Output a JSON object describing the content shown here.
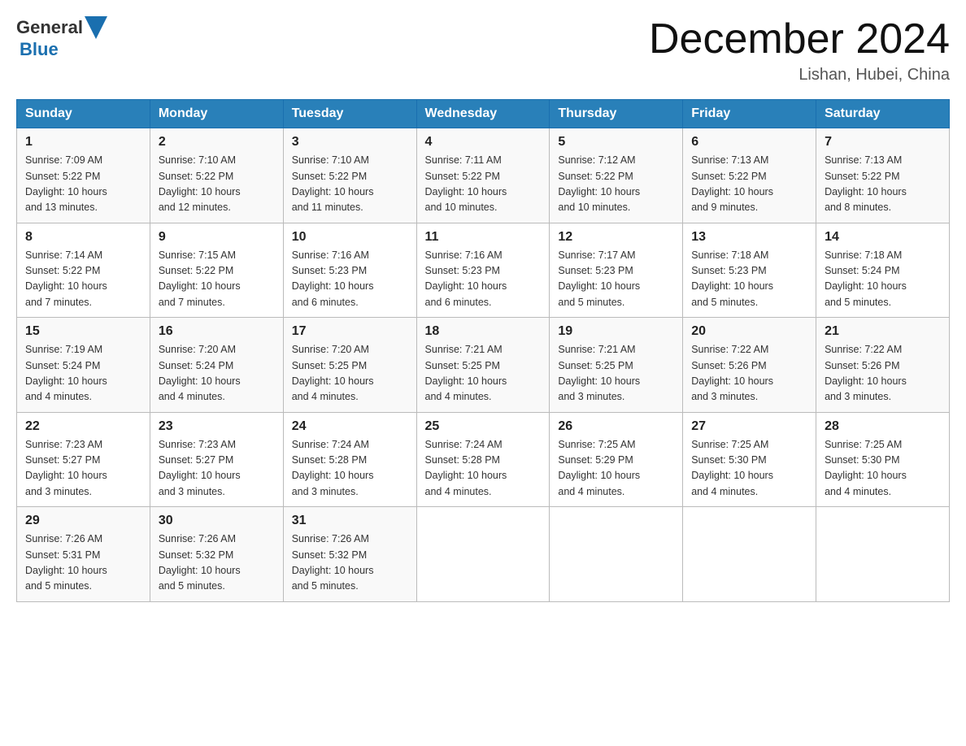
{
  "header": {
    "logo_general": "General",
    "logo_blue": "Blue",
    "month_title": "December 2024",
    "location": "Lishan, Hubei, China"
  },
  "days_of_week": [
    "Sunday",
    "Monday",
    "Tuesday",
    "Wednesday",
    "Thursday",
    "Friday",
    "Saturday"
  ],
  "weeks": [
    [
      {
        "day": "1",
        "sunrise": "7:09 AM",
        "sunset": "5:22 PM",
        "daylight": "10 hours and 13 minutes."
      },
      {
        "day": "2",
        "sunrise": "7:10 AM",
        "sunset": "5:22 PM",
        "daylight": "10 hours and 12 minutes."
      },
      {
        "day": "3",
        "sunrise": "7:10 AM",
        "sunset": "5:22 PM",
        "daylight": "10 hours and 11 minutes."
      },
      {
        "day": "4",
        "sunrise": "7:11 AM",
        "sunset": "5:22 PM",
        "daylight": "10 hours and 10 minutes."
      },
      {
        "day": "5",
        "sunrise": "7:12 AM",
        "sunset": "5:22 PM",
        "daylight": "10 hours and 10 minutes."
      },
      {
        "day": "6",
        "sunrise": "7:13 AM",
        "sunset": "5:22 PM",
        "daylight": "10 hours and 9 minutes."
      },
      {
        "day": "7",
        "sunrise": "7:13 AM",
        "sunset": "5:22 PM",
        "daylight": "10 hours and 8 minutes."
      }
    ],
    [
      {
        "day": "8",
        "sunrise": "7:14 AM",
        "sunset": "5:22 PM",
        "daylight": "10 hours and 7 minutes."
      },
      {
        "day": "9",
        "sunrise": "7:15 AM",
        "sunset": "5:22 PM",
        "daylight": "10 hours and 7 minutes."
      },
      {
        "day": "10",
        "sunrise": "7:16 AM",
        "sunset": "5:23 PM",
        "daylight": "10 hours and 6 minutes."
      },
      {
        "day": "11",
        "sunrise": "7:16 AM",
        "sunset": "5:23 PM",
        "daylight": "10 hours and 6 minutes."
      },
      {
        "day": "12",
        "sunrise": "7:17 AM",
        "sunset": "5:23 PM",
        "daylight": "10 hours and 5 minutes."
      },
      {
        "day": "13",
        "sunrise": "7:18 AM",
        "sunset": "5:23 PM",
        "daylight": "10 hours and 5 minutes."
      },
      {
        "day": "14",
        "sunrise": "7:18 AM",
        "sunset": "5:24 PM",
        "daylight": "10 hours and 5 minutes."
      }
    ],
    [
      {
        "day": "15",
        "sunrise": "7:19 AM",
        "sunset": "5:24 PM",
        "daylight": "10 hours and 4 minutes."
      },
      {
        "day": "16",
        "sunrise": "7:20 AM",
        "sunset": "5:24 PM",
        "daylight": "10 hours and 4 minutes."
      },
      {
        "day": "17",
        "sunrise": "7:20 AM",
        "sunset": "5:25 PM",
        "daylight": "10 hours and 4 minutes."
      },
      {
        "day": "18",
        "sunrise": "7:21 AM",
        "sunset": "5:25 PM",
        "daylight": "10 hours and 4 minutes."
      },
      {
        "day": "19",
        "sunrise": "7:21 AM",
        "sunset": "5:25 PM",
        "daylight": "10 hours and 3 minutes."
      },
      {
        "day": "20",
        "sunrise": "7:22 AM",
        "sunset": "5:26 PM",
        "daylight": "10 hours and 3 minutes."
      },
      {
        "day": "21",
        "sunrise": "7:22 AM",
        "sunset": "5:26 PM",
        "daylight": "10 hours and 3 minutes."
      }
    ],
    [
      {
        "day": "22",
        "sunrise": "7:23 AM",
        "sunset": "5:27 PM",
        "daylight": "10 hours and 3 minutes."
      },
      {
        "day": "23",
        "sunrise": "7:23 AM",
        "sunset": "5:27 PM",
        "daylight": "10 hours and 3 minutes."
      },
      {
        "day": "24",
        "sunrise": "7:24 AM",
        "sunset": "5:28 PM",
        "daylight": "10 hours and 3 minutes."
      },
      {
        "day": "25",
        "sunrise": "7:24 AM",
        "sunset": "5:28 PM",
        "daylight": "10 hours and 4 minutes."
      },
      {
        "day": "26",
        "sunrise": "7:25 AM",
        "sunset": "5:29 PM",
        "daylight": "10 hours and 4 minutes."
      },
      {
        "day": "27",
        "sunrise": "7:25 AM",
        "sunset": "5:30 PM",
        "daylight": "10 hours and 4 minutes."
      },
      {
        "day": "28",
        "sunrise": "7:25 AM",
        "sunset": "5:30 PM",
        "daylight": "10 hours and 4 minutes."
      }
    ],
    [
      {
        "day": "29",
        "sunrise": "7:26 AM",
        "sunset": "5:31 PM",
        "daylight": "10 hours and 5 minutes."
      },
      {
        "day": "30",
        "sunrise": "7:26 AM",
        "sunset": "5:32 PM",
        "daylight": "10 hours and 5 minutes."
      },
      {
        "day": "31",
        "sunrise": "7:26 AM",
        "sunset": "5:32 PM",
        "daylight": "10 hours and 5 minutes."
      },
      null,
      null,
      null,
      null
    ]
  ],
  "labels": {
    "sunrise": "Sunrise:",
    "sunset": "Sunset:",
    "daylight": "Daylight:"
  }
}
